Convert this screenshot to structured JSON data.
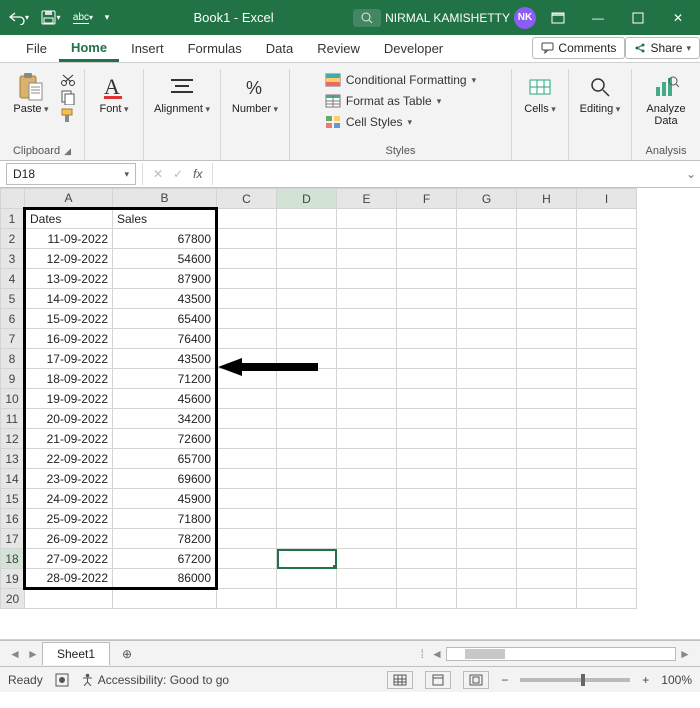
{
  "titlebar": {
    "autosave": "⤺",
    "save_icon": "💾",
    "abc_icon": "abc",
    "title": "Book1 - Excel",
    "search_placeholder": "Search",
    "username": "NIRMAL KAMISHETTY",
    "initials": "NK"
  },
  "tabs": {
    "file": "File",
    "home": "Home",
    "insert": "Insert",
    "formulas": "Formulas",
    "data": "Data",
    "review": "Review",
    "developer": "Developer",
    "comments": "Comments",
    "share": "Share"
  },
  "ribbon": {
    "clipboard": {
      "paste": "Paste",
      "group": "Clipboard"
    },
    "font": {
      "label": "Font",
      "group": "Font"
    },
    "alignment": {
      "label": "Alignment",
      "group": "Alignment"
    },
    "number": {
      "label": "Number",
      "group": "Number"
    },
    "styles": {
      "cond": "Conditional Formatting",
      "table": "Format as Table",
      "cell": "Cell Styles",
      "group": "Styles"
    },
    "cells": {
      "label": "Cells",
      "group": "Cells"
    },
    "editing": {
      "label": "Editing",
      "group": "Editing"
    },
    "analysis": {
      "label": "Analyze Data",
      "group": "Analysis"
    }
  },
  "formula_bar": {
    "namebox": "D18",
    "fx": "fx"
  },
  "columns": [
    "A",
    "B",
    "C",
    "D",
    "E",
    "F",
    "G",
    "H",
    "I"
  ],
  "headers": {
    "a": "Dates",
    "b": "Sales"
  },
  "rows": [
    {
      "n": 1
    },
    {
      "n": 2,
      "a": "11-09-2022",
      "b": "67800"
    },
    {
      "n": 3,
      "a": "12-09-2022",
      "b": "54600"
    },
    {
      "n": 4,
      "a": "13-09-2022",
      "b": "87900"
    },
    {
      "n": 5,
      "a": "14-09-2022",
      "b": "43500"
    },
    {
      "n": 6,
      "a": "15-09-2022",
      "b": "65400"
    },
    {
      "n": 7,
      "a": "16-09-2022",
      "b": "76400"
    },
    {
      "n": 8,
      "a": "17-09-2022",
      "b": "43500"
    },
    {
      "n": 9,
      "a": "18-09-2022",
      "b": "71200"
    },
    {
      "n": 10,
      "a": "19-09-2022",
      "b": "45600"
    },
    {
      "n": 11,
      "a": "20-09-2022",
      "b": "34200"
    },
    {
      "n": 12,
      "a": "21-09-2022",
      "b": "72600"
    },
    {
      "n": 13,
      "a": "22-09-2022",
      "b": "65700"
    },
    {
      "n": 14,
      "a": "23-09-2022",
      "b": "69600"
    },
    {
      "n": 15,
      "a": "24-09-2022",
      "b": "45900"
    },
    {
      "n": 16,
      "a": "25-09-2022",
      "b": "71800"
    },
    {
      "n": 17,
      "a": "26-09-2022",
      "b": "78200"
    },
    {
      "n": 18,
      "a": "27-09-2022",
      "b": "67200"
    },
    {
      "n": 19,
      "a": "28-09-2022",
      "b": "86000"
    },
    {
      "n": 20
    }
  ],
  "selected": {
    "row": 18,
    "col": "D"
  },
  "sheet": {
    "name": "Sheet1",
    "add": "+"
  },
  "statusbar": {
    "ready": "Ready",
    "access": "Accessibility: Good to go",
    "zoom": "100%"
  }
}
